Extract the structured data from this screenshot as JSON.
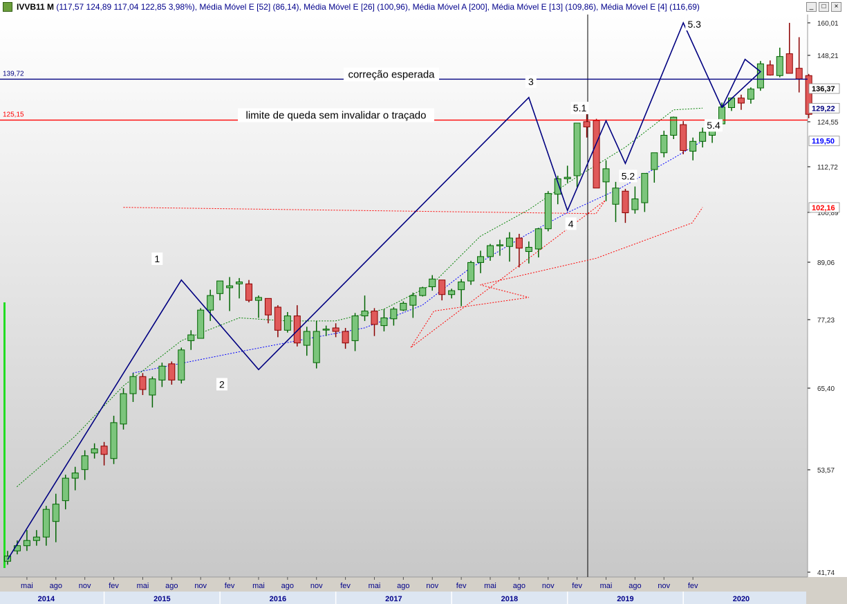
{
  "title": {
    "symbol": "IVVB11 M",
    "ohlc": "(117,57  124,89  117,04  122,85  3,98%)",
    "indicators": ", Média Móvel E [52] (86,14), Média Móvel E [26] (100,96), Média Móvel A [200], Média Móvel E [13] (109,86), Média Móvel E [4] (116,69)"
  },
  "window_buttons": {
    "minimize": "_",
    "restore": "□",
    "close": "×"
  },
  "chart_data": {
    "type": "candlestick",
    "ylim": [
      41.74,
      160.01
    ],
    "y_ticks": [
      {
        "value": 160.01,
        "label": "160,01"
      },
      {
        "value": 148.21,
        "label": "148,21"
      },
      {
        "value": 124.55,
        "label": "124,55"
      },
      {
        "value": 112.72,
        "label": "112,72"
      },
      {
        "value": 100.89,
        "label": "100,89"
      },
      {
        "value": 89.06,
        "label": "89,06"
      },
      {
        "value": 77.23,
        "label": "77,23"
      },
      {
        "value": 65.4,
        "label": "65,40"
      },
      {
        "value": 53.57,
        "label": "53,57"
      },
      {
        "value": 41.74,
        "label": "41,74"
      }
    ],
    "price_tags": [
      {
        "value": 136.37,
        "label": "136,37",
        "color": "#000000"
      },
      {
        "value": 129.4,
        "label": "129,22",
        "color": "#000080"
      },
      {
        "value": 119.5,
        "label": "119,50",
        "color": "#0000ff"
      },
      {
        "value": 102.16,
        "label": "102,16",
        "color": "#ff0000"
      }
    ],
    "hlines": [
      {
        "value": 139.72,
        "label": "139,72",
        "color": "#000080",
        "annotation": "correção esperada"
      },
      {
        "value": 125.15,
        "label": "125,15",
        "color": "#ff0000",
        "annotation": "limite de queda sem invalidar o traçado"
      }
    ],
    "month_labels": [
      "mai",
      "ago",
      "nov",
      "fev",
      "mai",
      "ago",
      "nov",
      "fev",
      "mai",
      "ago",
      "nov",
      "fev",
      "mai",
      "ago",
      "nov",
      "fev",
      "mai",
      "ago",
      "nov",
      "fev",
      "mai",
      "ago",
      "nov",
      "fev"
    ],
    "year_labels": [
      "2014",
      "2015",
      "2016",
      "2017",
      "2018",
      "2019",
      "2020"
    ],
    "candles": [
      [
        43.0,
        44.2,
        42.6,
        43.6
      ],
      [
        44.2,
        45.4,
        43.8,
        44.8
      ],
      [
        44.8,
        46.6,
        44.2,
        45.4
      ],
      [
        45.4,
        46.6,
        44.8,
        45.8
      ],
      [
        45.8,
        49.4,
        44.8,
        49.0
      ],
      [
        47.6,
        50.8,
        45.2,
        49.6
      ],
      [
        50.0,
        53.0,
        49.0,
        52.6
      ],
      [
        52.6,
        54.0,
        51.2,
        53.2
      ],
      [
        53.6,
        56.4,
        52.4,
        55.6
      ],
      [
        56.0,
        57.4,
        55.2,
        56.6
      ],
      [
        57.0,
        57.6,
        54.2,
        55.8
      ],
      [
        55.2,
        61.4,
        54.4,
        60.4
      ],
      [
        60.2,
        65.4,
        59.4,
        64.6
      ],
      [
        64.6,
        68.0,
        63.4,
        67.4
      ],
      [
        67.4,
        68.0,
        64.4,
        65.2
      ],
      [
        64.4,
        67.4,
        62.6,
        67.0
      ],
      [
        66.8,
        69.8,
        65.6,
        69.2
      ],
      [
        69.6,
        70.0,
        66.0,
        66.8
      ],
      [
        66.8,
        72.4,
        66.2,
        72.0
      ],
      [
        73.6,
        75.4,
        72.0,
        74.6
      ],
      [
        74.0,
        79.6,
        74.0,
        79.2
      ],
      [
        79.2,
        83.4,
        77.0,
        82.2
      ],
      [
        82.6,
        85.2,
        81.2,
        85.2
      ],
      [
        83.8,
        86.0,
        79.0,
        84.2
      ],
      [
        84.6,
        85.8,
        81.6,
        85.0
      ],
      [
        84.6,
        85.4,
        80.8,
        81.2
      ],
      [
        81.2,
        82.2,
        77.6,
        81.8
      ],
      [
        81.6,
        81.6,
        76.6,
        78.2
      ],
      [
        79.8,
        80.2,
        74.2,
        75.4
      ],
      [
        75.4,
        78.8,
        75.0,
        78.0
      ],
      [
        78.0,
        80.2,
        72.6,
        73.2
      ],
      [
        72.8,
        76.0,
        71.0,
        75.2
      ],
      [
        69.8,
        77.0,
        68.8,
        75.2
      ],
      [
        75.6,
        76.2,
        74.4,
        75.6
      ],
      [
        75.8,
        76.6,
        74.2,
        75.2
      ],
      [
        75.2,
        75.8,
        72.2,
        73.2
      ],
      [
        73.6,
        78.6,
        71.8,
        78.0
      ],
      [
        78.0,
        82.2,
        77.0,
        79.0
      ],
      [
        79.0,
        79.6,
        74.4,
        76.4
      ],
      [
        76.2,
        79.4,
        75.2,
        77.6
      ],
      [
        77.4,
        79.8,
        76.2,
        79.4
      ],
      [
        79.2,
        81.0,
        79.0,
        80.6
      ],
      [
        80.2,
        82.8,
        77.6,
        82.2
      ],
      [
        82.2,
        84.0,
        82.0,
        83.8
      ],
      [
        84.0,
        86.4,
        83.2,
        85.6
      ],
      [
        85.4,
        85.4,
        81.2,
        82.4
      ],
      [
        82.4,
        83.6,
        81.6,
        83.2
      ],
      [
        83.4,
        85.6,
        80.0,
        85.0
      ],
      [
        85.2,
        89.4,
        84.4,
        89.0
      ],
      [
        89.0,
        91.8,
        86.8,
        90.4
      ],
      [
        90.4,
        93.4,
        89.4,
        93.0
      ],
      [
        93.0,
        94.4,
        90.6,
        93.2
      ],
      [
        92.8,
        96.2,
        89.2,
        94.8
      ],
      [
        94.8,
        95.8,
        88.0,
        92.4
      ],
      [
        91.6,
        94.0,
        88.8,
        92.6
      ],
      [
        92.2,
        97.2,
        90.2,
        97.0
      ],
      [
        97.0,
        106.4,
        96.4,
        105.8
      ],
      [
        105.6,
        110.4,
        103.0,
        109.6
      ],
      [
        109.6,
        113.0,
        108.6,
        110.0
      ],
      [
        110.4,
        121.4,
        107.4,
        124.2
      ],
      [
        124.6,
        130.4,
        120.4,
        123.2
      ],
      [
        125.0,
        125.6,
        108.0,
        107.2
      ],
      [
        108.8,
        114.4,
        103.8,
        112.2
      ],
      [
        103.0,
        108.8,
        98.6,
        107.2
      ],
      [
        106.4,
        107.0,
        98.4,
        100.8
      ],
      [
        101.6,
        107.6,
        100.6,
        104.4
      ],
      [
        103.4,
        108.6,
        101.0,
        111.0
      ],
      [
        112.0,
        113.8,
        108.6,
        116.4
      ],
      [
        116.4,
        122.2,
        115.2,
        121.0
      ],
      [
        121.0,
        126.4,
        120.0,
        126.2
      ],
      [
        123.8,
        124.8,
        116.0,
        117.0
      ],
      [
        116.8,
        120.4,
        114.4,
        119.4
      ],
      [
        119.4,
        123.0,
        117.8,
        121.8
      ],
      [
        121.0,
        123.6,
        119.0,
        124.0
      ],
      [
        124.0,
        131.4,
        122.4,
        129.8
      ],
      [
        129.6,
        133.2,
        128.4,
        133.0
      ],
      [
        133.0,
        134.2,
        128.8,
        131.2
      ],
      [
        132.6,
        136.8,
        131.0,
        136.2
      ],
      [
        136.6,
        146.2,
        135.6,
        145.2
      ],
      [
        144.8,
        146.4,
        141.0,
        141.2
      ],
      [
        141.0,
        151.0,
        140.4,
        147.8
      ],
      [
        148.8,
        160.0,
        142.2,
        141.8
      ],
      [
        143.6,
        154.8,
        135.0,
        139.8
      ],
      [
        141.0,
        141.6,
        125.8,
        127.2
      ]
    ],
    "series": [
      {
        "name": "Média Móvel E [52]",
        "color": "#ff0000",
        "values": [
          [
            2014.92,
            102.2
          ],
          [
            2019.0,
            100.6
          ],
          [
            2019.08,
            104.0
          ],
          [
            2017.4,
            72.4
          ],
          [
            2017.6,
            79.0
          ],
          [
            2018.42,
            81.8
          ],
          [
            2018.0,
            84.4
          ],
          [
            2019.0,
            90.0
          ],
          [
            2019.83,
            98.4
          ],
          [
            2019.92,
            102.2
          ]
        ]
      },
      {
        "name": "Média Móvel E [26]",
        "color": "#0000ff",
        "values": [
          [
            2015.0,
            68.0
          ],
          [
            2016.0,
            72.0
          ],
          [
            2017.0,
            75.8
          ],
          [
            2017.5,
            80.2
          ],
          [
            2017.9,
            87.6
          ],
          [
            2018.4,
            95.6
          ],
          [
            2018.75,
            100.8
          ],
          [
            2019.2,
            107.0
          ],
          [
            2019.67,
            115.0
          ],
          [
            2019.92,
            119.5
          ]
        ]
      },
      {
        "name": "Média Móvel E [13]",
        "color": "#008000",
        "values": [
          [
            2014.0,
            51.6
          ],
          [
            2014.5,
            58.4
          ],
          [
            2014.92,
            65.8
          ],
          [
            2015.42,
            73.6
          ],
          [
            2015.92,
            77.6
          ],
          [
            2016.33,
            77.0
          ],
          [
            2016.75,
            77.0
          ],
          [
            2017.17,
            79.4
          ],
          [
            2017.58,
            84.4
          ],
          [
            2018.0,
            95.2
          ],
          [
            2018.42,
            101.6
          ],
          [
            2018.83,
            110.0
          ],
          [
            2019.25,
            117.8
          ],
          [
            2019.67,
            128.8
          ],
          [
            2019.92,
            129.4
          ]
        ]
      },
      {
        "name": "Média Móvel E [4]",
        "color": "#000000",
        "values": []
      }
    ],
    "wave_labels": [
      "1",
      "2",
      "3",
      "4",
      "5.1",
      "5.2",
      "5.3",
      "5.4"
    ]
  }
}
